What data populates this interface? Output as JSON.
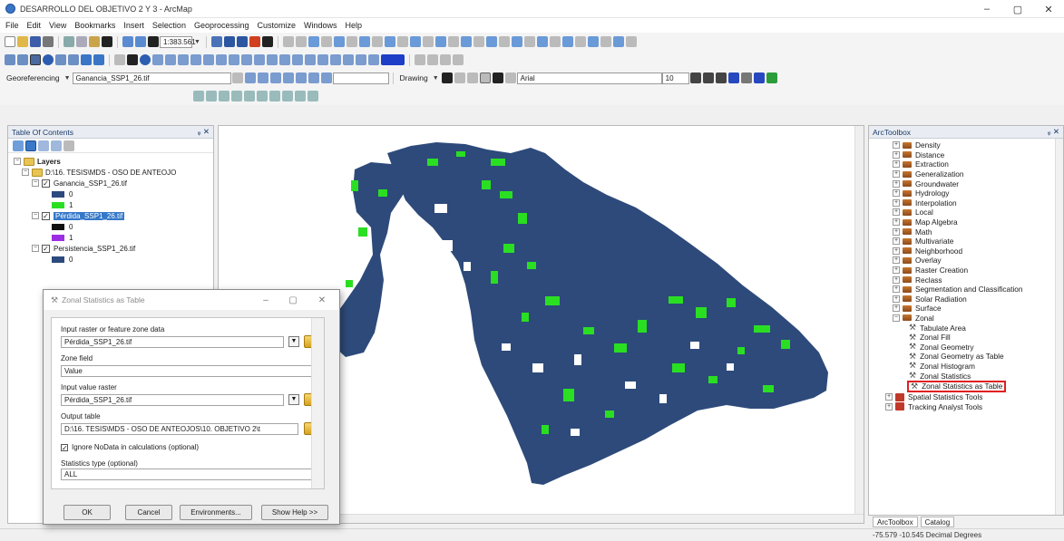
{
  "window": {
    "title": "DESARROLLO DEL OBJETIVO 2 Y 3 - ArcMap",
    "controls": [
      "–",
      "▢",
      "✕"
    ]
  },
  "menu": [
    "File",
    "Edit",
    "View",
    "Bookmarks",
    "Insert",
    "Selection",
    "Geoprocessing",
    "Customize",
    "Windows",
    "Help"
  ],
  "toolbars": {
    "scale": "1:383.561",
    "georef_label": "Georeferencing",
    "georef_layer": "Ganancia_SSP1_26.tif",
    "drawing_label": "Drawing",
    "font_name": "Arial",
    "font_size": "10"
  },
  "toc": {
    "title": "Table Of Contents",
    "root": "Layers",
    "folder": "D:\\16. TESIS\\MDS - OSO DE ANTEOJO",
    "layers": [
      {
        "name": "Ganancia_SSP1_26.tif",
        "legend": [
          {
            "label": "0",
            "color": "#2c4a7e"
          },
          {
            "label": "1",
            "color": "#2adf22"
          }
        ]
      },
      {
        "name": "Pérdida_SSP1_26.tif",
        "legend": [
          {
            "label": "0",
            "color": "#111111"
          },
          {
            "label": "1",
            "color": "#9b2ee3"
          }
        ]
      },
      {
        "name": "Persistencia_SSP1_26.tif",
        "legend": [
          {
            "label": "0",
            "color": "#2c4a7e"
          }
        ]
      }
    ]
  },
  "dialog": {
    "title": "Zonal Statistics as Table",
    "input_zone_label": "Input raster or feature zone data",
    "input_zone_value": "Pérdida_SSP1_26.tif",
    "zone_field_label": "Zone field",
    "zone_field_value": "Value",
    "input_value_label": "Input value raster",
    "input_value_value": "Pérdida_SSP1_26.tif",
    "output_label": "Output table",
    "output_value": "D:\\16. TESIS\\MDS - OSO DE ANTEOJOS\\10. OBJETIVO 2\\t",
    "ignore_nodata_label": "Ignore NoData in calculations (optional)",
    "stats_label": "Statistics type (optional)",
    "stats_value": "ALL",
    "buttons": {
      "ok": "OK",
      "cancel": "Cancel",
      "environments": "Environments...",
      "help": "Show Help >>"
    }
  },
  "toolbox": {
    "title": "ArcToolbox",
    "items": [
      "Density",
      "Distance",
      "Extraction",
      "Generalization",
      "Groundwater",
      "Hydrology",
      "Interpolation",
      "Local",
      "Map Algebra",
      "Math",
      "Multivariate",
      "Neighborhood",
      "Overlay",
      "Raster Creation",
      "Reclass",
      "Segmentation and Classification",
      "Solar Radiation",
      "Surface",
      "Zonal"
    ],
    "zonal_tools": [
      "Tabulate Area",
      "Zonal Fill",
      "Zonal Geometry",
      "Zonal Geometry as Table",
      "Zonal Histogram",
      "Zonal Statistics",
      "Zonal Statistics as Table"
    ],
    "extra": [
      "Spatial Statistics Tools",
      "Tracking Analyst Tools"
    ],
    "tabs": [
      "ArcToolbox",
      "Catalog"
    ]
  },
  "status": {
    "coords": "-75.579  -10.545 Decimal Degrees"
  },
  "colors": {
    "map_fill": "#2d4a7a",
    "gain_green": "#2adf22",
    "highlight_red": "#e02020",
    "selection_blue": "#3578c9"
  }
}
